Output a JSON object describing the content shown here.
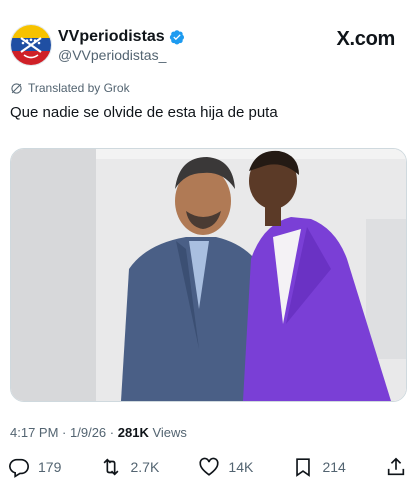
{
  "author": {
    "display_name": "VVperiodistas",
    "handle": "@VVperiodistas_",
    "verified": true
  },
  "platform": {
    "logo_text": "X.com"
  },
  "tweet": {
    "translated_label": "Translated by Grok",
    "text": "Que nadie se olvide de esta hija de puta"
  },
  "meta": {
    "time": "4:17 PM",
    "date": "1/9/26",
    "separator": "·",
    "views_count": "281K",
    "views_label": "Views"
  },
  "actions": {
    "replies": "179",
    "reposts": "2.7K",
    "likes": "14K",
    "bookmarks": "214"
  },
  "colors": {
    "verified_blue": "#1d9bf0",
    "secondary_text": "#536471",
    "primary_text": "#0f1419"
  }
}
